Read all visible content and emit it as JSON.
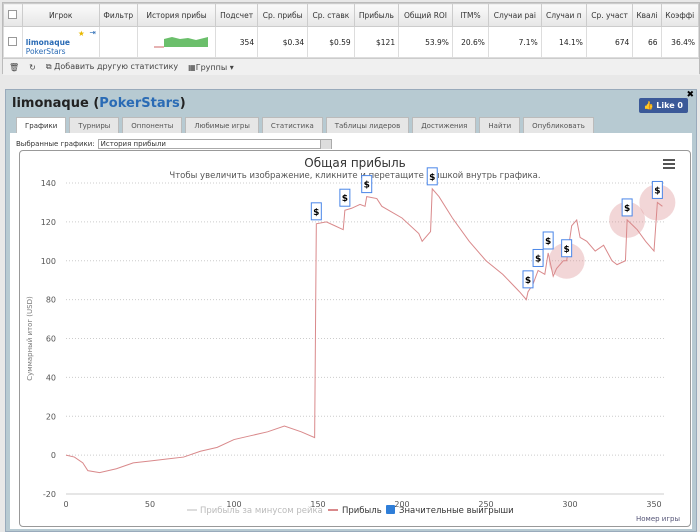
{
  "stats_table": {
    "columns": [
      "Игрок",
      "Фильтр",
      "История прибы",
      "Подсчет",
      "Ср. прибы",
      "Ср. ставк",
      "Прибыль",
      "Общий ROI",
      "ITM%",
      "Случаи раі",
      "Случаи п",
      "Ср. участ",
      "Квалі",
      "Коэффі"
    ],
    "row": {
      "player": "limonaque",
      "site": "PokerStars",
      "values": [
        "354",
        "$0.34",
        "$0.59",
        "$121",
        "53.9%",
        "20.6%",
        "7.1%",
        "14.1%",
        "674",
        "66",
        "36.4%"
      ]
    },
    "footer": {
      "add_stat": "Добавить другую статистику",
      "groups": "Группы"
    }
  },
  "panel": {
    "player": "limonaque",
    "site": "PokerStars",
    "like": "Like 0",
    "tabs": [
      "Графики",
      "Турниры",
      "Оппоненты",
      "Любимые игры",
      "Статистика",
      "Таблицы лидеров",
      "Достижения",
      "Найти",
      "Опубликовать"
    ],
    "active_tab": "Графики",
    "selected_label": "Выбранные графики:",
    "selected_value": "История прибыли"
  },
  "chart_data": {
    "type": "line",
    "title": "Общая прибыль",
    "subtitle": "Чтобы увеличить изображение, кликните и перетащите мышкой внутрь графика.",
    "xlabel": "Номер игры",
    "ylabel": "Суммарный итог (USD)",
    "xlim": [
      0,
      355
    ],
    "ylim": [
      -20,
      140
    ],
    "xticks": [
      0,
      50,
      100,
      150,
      200,
      250,
      300,
      350
    ],
    "yticks": [
      -20,
      0,
      20,
      40,
      60,
      80,
      100,
      120,
      140
    ],
    "grid": "horizontal dotted",
    "legend": [
      "Прибыль за минусом рейка",
      "Прибыль",
      "Значительные выигрыши"
    ],
    "legend_position": "bottom",
    "series": [
      {
        "name": "Прибыль",
        "color": "#d9898b",
        "x": [
          0,
          5,
          10,
          13,
          20,
          30,
          40,
          50,
          60,
          70,
          80,
          90,
          100,
          110,
          120,
          130,
          140,
          148,
          149,
          155,
          160,
          165,
          166,
          170,
          175,
          178,
          179,
          185,
          188,
          200,
          210,
          212,
          217,
          218,
          222,
          230,
          240,
          250,
          260,
          270,
          274,
          275,
          278,
          281,
          285,
          287,
          290,
          292,
          296,
          298,
          301,
          304,
          306,
          310,
          315,
          320,
          325,
          328,
          333,
          334,
          340,
          345,
          350,
          352,
          355
        ],
        "y": [
          0,
          -1,
          -4,
          -8,
          -9,
          -7,
          -4,
          -3,
          -2,
          -1,
          2,
          4,
          8,
          10,
          12,
          15,
          12,
          9,
          119,
          120,
          118,
          116,
          126,
          127,
          129,
          128,
          133,
          132,
          128,
          122,
          114,
          110,
          115,
          137,
          133,
          122,
          110,
          100,
          93,
          84,
          80,
          84,
          88,
          95,
          93,
          104,
          92,
          96,
          100,
          100,
          118,
          121,
          112,
          110,
          105,
          108,
          100,
          98,
          100,
          121,
          116,
          110,
          105,
          130,
          128
        ]
      }
    ],
    "big_wins_x": [
      149,
      166,
      179,
      218,
      275,
      281,
      287,
      298,
      334,
      352
    ],
    "highlighted_x": [
      298,
      334,
      352
    ],
    "flag_label": "$"
  }
}
